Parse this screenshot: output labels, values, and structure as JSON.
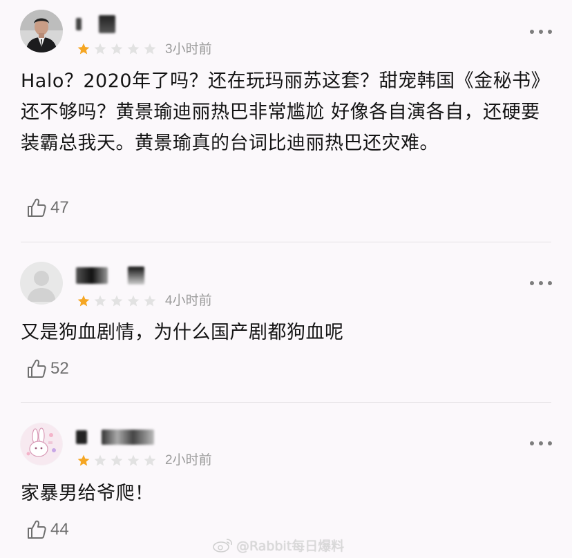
{
  "reviews": [
    {
      "username": "",
      "rating": 1,
      "max_rating": 5,
      "time": "3小时前",
      "text": "Halo？2020年了吗？还在玩玛丽苏这套？甜宠韩国《金秘书》还不够吗？黄景瑜迪丽热巴非常尴尬 好像各自演各自，还硬要装霸总我天。黄景瑜真的台词比迪丽热巴还灾难。",
      "likes": "47",
      "avatar": "man-in-suit-avatar"
    },
    {
      "username": "",
      "rating": 1,
      "max_rating": 5,
      "time": "4小时前",
      "text": "又是狗血剧情，为什么国产剧都狗血呢",
      "likes": "52",
      "avatar": "default-person-avatar"
    },
    {
      "username": "",
      "rating": 1,
      "max_rating": 5,
      "time": "2小时前",
      "text": "家暴男给爷爬！",
      "likes": "44",
      "avatar": "bunny-avatar"
    }
  ],
  "watermark": "@Rabbit每日爆料",
  "colors": {
    "star_filled": "#f5a623",
    "star_empty": "#e2e2e2",
    "background": "#fbf8fb",
    "meta_text": "#9c9c9c"
  },
  "icons": [
    "more-icon",
    "thumbs-up-icon",
    "star-icon",
    "weibo-logo-icon"
  ]
}
